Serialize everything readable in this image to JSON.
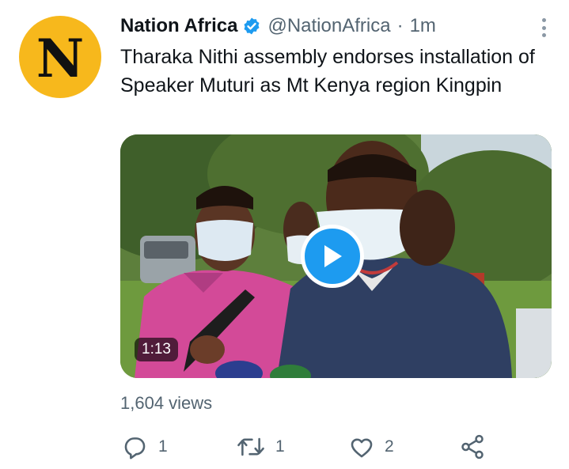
{
  "tweet": {
    "avatar_letter": "N",
    "author_name": "Nation Africa",
    "handle": "@NationAfrica",
    "separator": "·",
    "timestamp": "1m",
    "text": "Tharaka Nithi assembly endorses installation of Speaker Muturi as Mt Kenya region Kingpin",
    "video_duration": "1:13",
    "views": "1,604 views",
    "actions": {
      "reply_count": "1",
      "retweet_count": "1",
      "like_count": "2"
    }
  },
  "colors": {
    "accent": "#1d9bf0",
    "avatar_bg": "#f7b81c",
    "secondary_text": "#536471"
  },
  "icons": [
    "verified-badge-icon",
    "more-options-icon",
    "play-icon",
    "reply-icon",
    "retweet-icon",
    "like-icon",
    "share-icon"
  ]
}
